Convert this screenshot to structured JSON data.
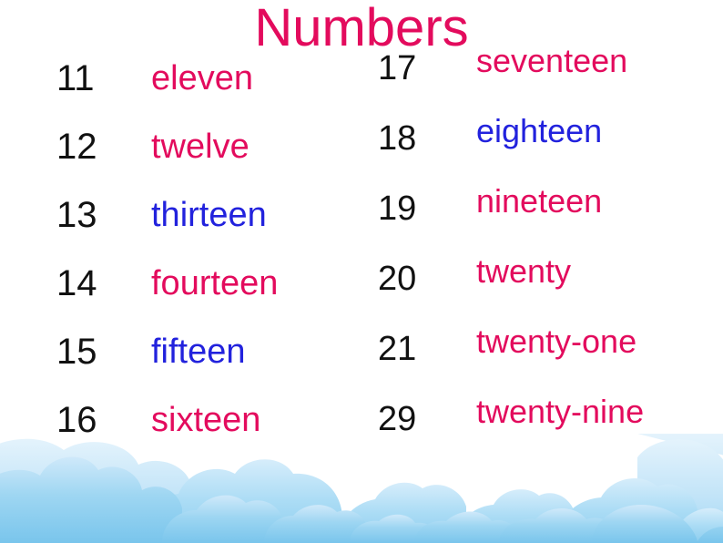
{
  "slide": {
    "title": "Numbers",
    "background_color": "#ffffff",
    "title_color": "#e30b5d"
  },
  "colors": {
    "pink": "#e30b5d",
    "blue": "#2222dd",
    "number_black": "#111111",
    "cloud_light": "#d9eefb",
    "cloud_mid": "#a9dbf4",
    "cloud_dark": "#79c5ec"
  },
  "columns": {
    "left": [
      {
        "digit": "11",
        "word": "eleven",
        "color": "pink"
      },
      {
        "digit": "12",
        "word": "twelve",
        "color": "pink"
      },
      {
        "digit": "13",
        "word": "thirteen",
        "color": "blue"
      },
      {
        "digit": "14",
        "word": "fourteen",
        "color": "pink"
      },
      {
        "digit": "15",
        "word": "fifteen",
        "color": "blue"
      },
      {
        "digit": "16",
        "word": "sixteen",
        "color": "pink"
      }
    ],
    "right": [
      {
        "digit": "17",
        "word": "seventeen",
        "color": "pink"
      },
      {
        "digit": "18",
        "word": "eighteen",
        "color": "blue"
      },
      {
        "digit": "19",
        "word": "nineteen",
        "color": "pink"
      },
      {
        "digit": "20",
        "word": "twenty",
        "color": "pink"
      },
      {
        "digit": "21",
        "word": "twenty-one",
        "color": "pink"
      },
      {
        "digit": "29",
        "word": "twenty-nine",
        "color": "pink"
      }
    ]
  },
  "decoration": {
    "name": "cloud-band",
    "description": "light blue layered clouds along the bottom edge"
  }
}
